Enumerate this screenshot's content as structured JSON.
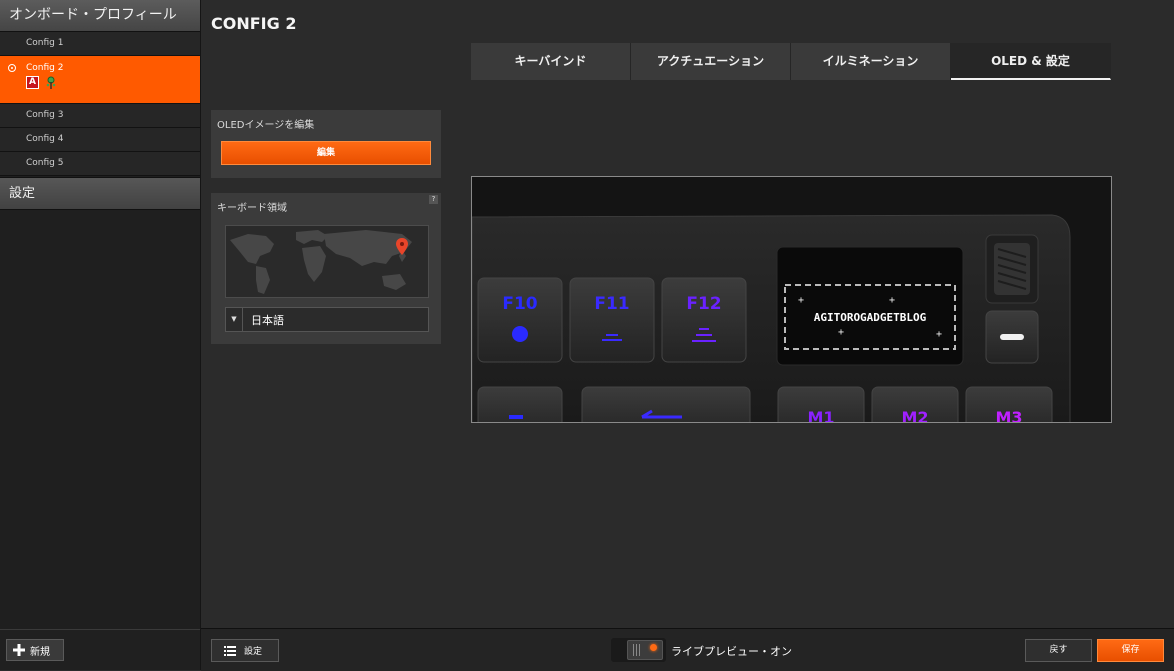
{
  "sidebar": {
    "header": "オンボード・プロフィール",
    "profiles": [
      {
        "label": "Config 1"
      },
      {
        "label": "Config 2",
        "active": true
      },
      {
        "label": "Config 3"
      },
      {
        "label": "Config 4"
      },
      {
        "label": "Config 5"
      }
    ],
    "settings_header": "設定",
    "new_button": "新規"
  },
  "main": {
    "title": "CONFIG 2",
    "tabs": [
      {
        "label": "キーバインド"
      },
      {
        "label": "アクチュエーション"
      },
      {
        "label": "イルミネーション"
      },
      {
        "label": "OLED & 設定",
        "active": true
      }
    ],
    "oled_panel": {
      "title": "OLEDイメージを編集",
      "edit_button": "編集"
    },
    "region_panel": {
      "title": "キーボード領域",
      "help": "?",
      "language_selected": "日本語"
    },
    "preview": {
      "keys_row1": [
        "F10",
        "F11",
        "F12"
      ],
      "oled_text": "AGITOROGADGETBLOG",
      "keys_row2": [
        "M1",
        "M2",
        "M3"
      ]
    }
  },
  "bottom": {
    "settings_button": "設定",
    "live_preview_label": "ライブプレビュー・オン",
    "revert_button": "戻す",
    "save_button": "保存"
  },
  "colors": {
    "accent": "#ff5a00",
    "key_blue": "#2a2aff",
    "key_purple": "#7a22ff",
    "key_magenta": "#c020ff"
  }
}
